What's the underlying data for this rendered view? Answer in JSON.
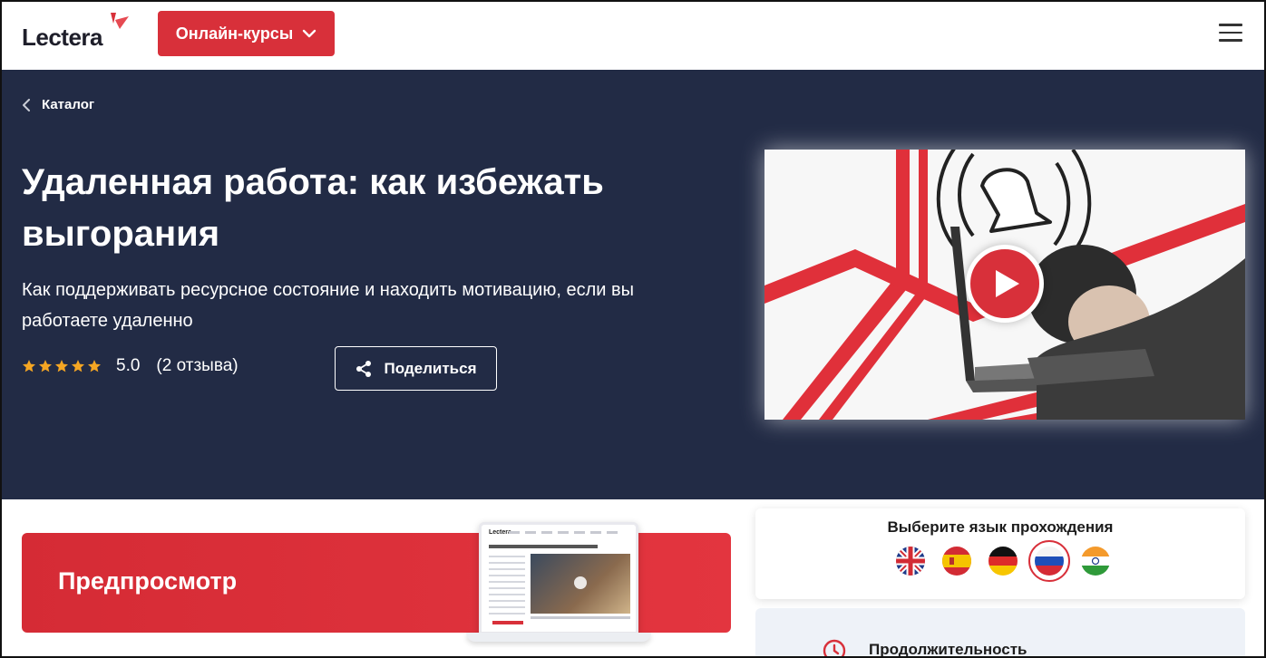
{
  "header": {
    "logo_text": "Lectera",
    "courses_button": "Онлайн-курсы",
    "menu_icon": "hamburger-menu-icon"
  },
  "hero": {
    "breadcrumb": "Каталог",
    "title": "Удаленная работа: как избежать выгорания",
    "subtitle": "Как поддерживать ресурсное состояние и находить мотивацию, если вы работаете удаленно",
    "rating_value": "5.0",
    "rating_stars": 5,
    "reviews": "(2 отзыва)",
    "share_label": "Поделиться",
    "video_play_icon": "play-icon"
  },
  "preview": {
    "label": "Предпросмотр"
  },
  "language": {
    "title": "Выберите язык прохождения",
    "options": [
      "english-flag",
      "spanish-flag",
      "german-flag",
      "russian-flag",
      "indian-flag"
    ],
    "selected": "russian-flag"
  },
  "details": {
    "duration_label": "Продолжительность"
  },
  "colors": {
    "accent": "#d8303a",
    "hero_bg": "#222b45",
    "star": "#f5a623"
  }
}
